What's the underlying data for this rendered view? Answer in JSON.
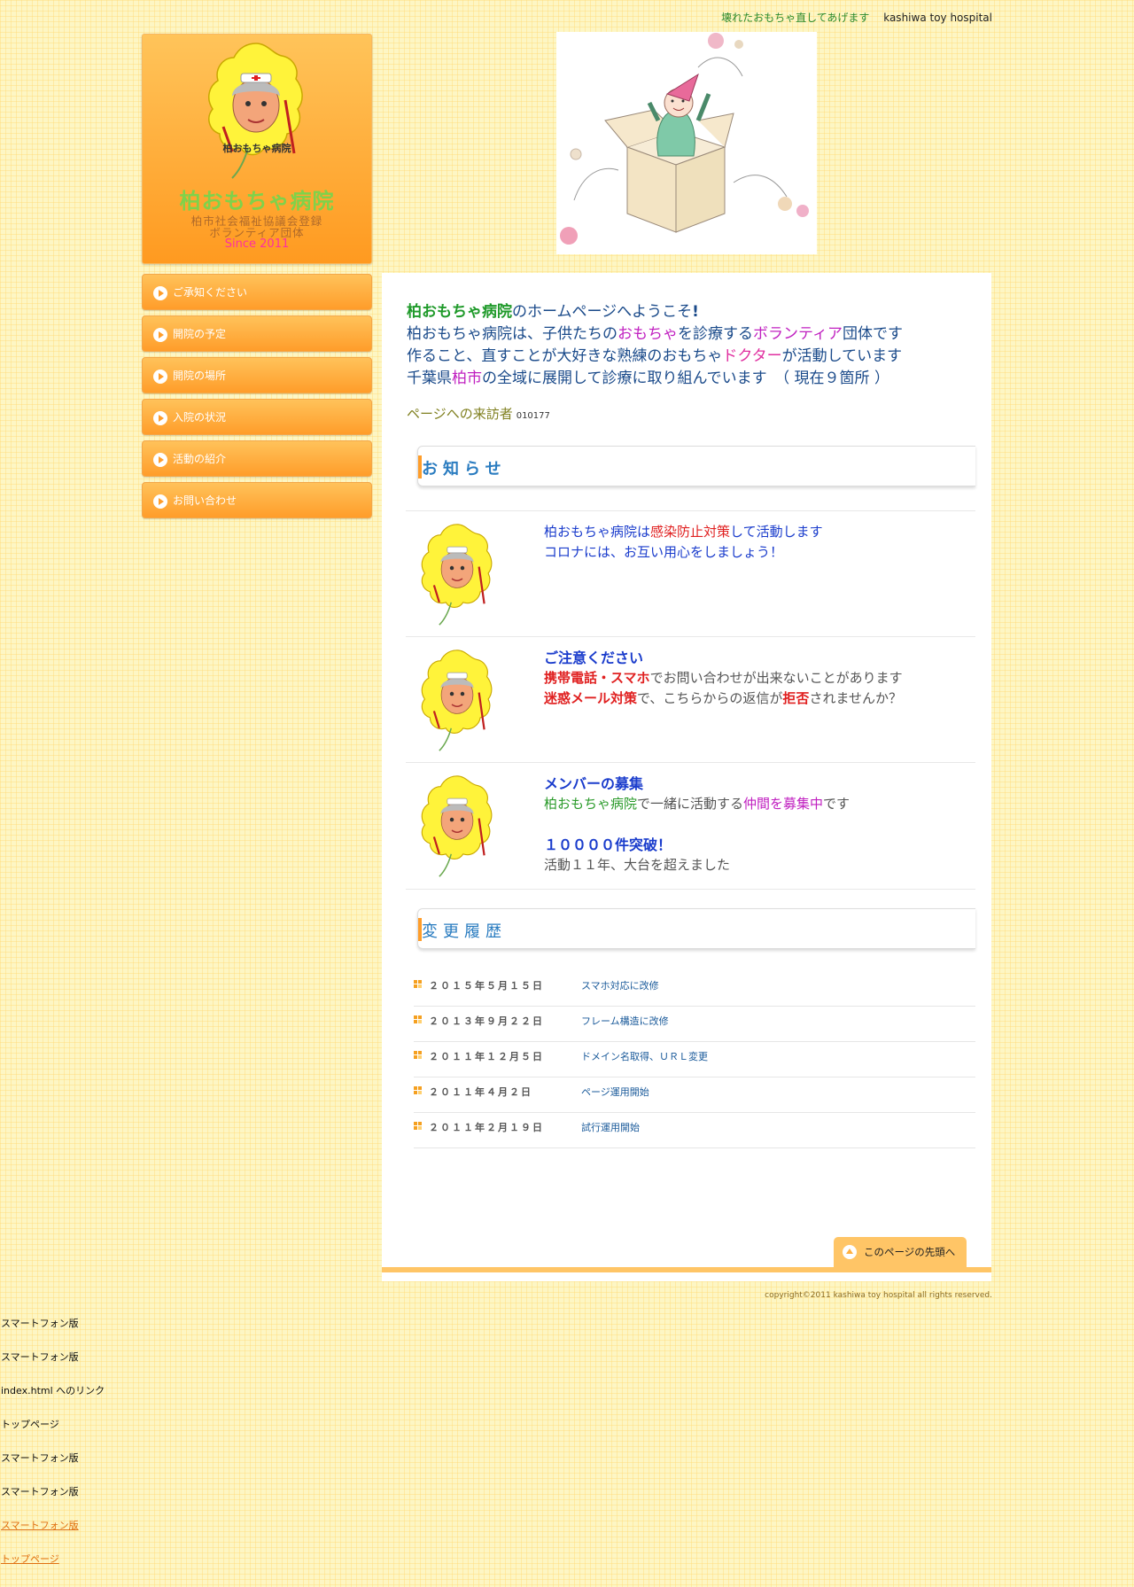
{
  "header": {
    "tagline_jp": "壊れたおもちゃ直してあげます",
    "tagline_en": "kashiwa toy hospital"
  },
  "logo": {
    "badge_text": "柏おもちゃ病院",
    "name": "柏おもちゃ病院",
    "registration_line1": "柏市社会福祉協議会登録",
    "registration_line2": "ボランティア団体",
    "since": "Since 2011"
  },
  "nav": {
    "items": [
      {
        "label": "ご承知ください"
      },
      {
        "label": "開院の予定"
      },
      {
        "label": "開院の場所"
      },
      {
        "label": "入院の状況"
      },
      {
        "label": "活動の紹介"
      },
      {
        "label": "お問い合わせ"
      }
    ]
  },
  "welcome": {
    "l1_a": "柏おもちゃ病院",
    "l1_b": "のホームページへようこそ",
    "l2_a": "柏おもちゃ病院は、子供たちの",
    "l2_b": "おもちゃ",
    "l2_c": "を診療する",
    "l2_d": "ボランティア",
    "l2_e": "団体です",
    "l3_a": "作ること、直すことが大好きな熟練のおもちゃ",
    "l3_b": "ドクター",
    "l3_c": "が活動しています",
    "l4_a": "千葉県",
    "l4_b": "柏市",
    "l4_c": "の全域に展開して診療に取り組んでいます　（ 現在９箇所 ）",
    "visitor_label": "ページへの来訪者",
    "visitor_count": "010177"
  },
  "notice": {
    "title": "お知らせ",
    "items": [
      {
        "a": "柏おもちゃ病院は",
        "b": "感染防止対策",
        "c": "して活動します",
        "d": "コロナには、お互い用心をしましょう！"
      },
      {
        "title": "ご注意ください",
        "a": "携帯電話・スマホ",
        "b": "でお問い合わせが出来ないことがあります",
        "c": "迷惑メール対策",
        "d": "で、こちらからの返信が",
        "e": "拒否",
        "f": "されませんか？"
      },
      {
        "title": "メンバーの募集",
        "a": "柏おもちゃ病院",
        "b": "で一緒に活動する",
        "c": "仲間を募集中",
        "d": "です",
        "e": "１００００件突破！",
        "f": "活動１１年、大台を超えました"
      }
    ]
  },
  "history": {
    "title": "変更履歴",
    "rows": [
      {
        "date": "２０１５年５月１５日",
        "desc": "スマホ対応に改修"
      },
      {
        "date": "２０１３年９月２２日",
        "desc": "フレーム構造に改修"
      },
      {
        "date": "２０１１年１２月５日",
        "desc": "ドメイン名取得、ＵＲＬ変更"
      },
      {
        "date": "２０１１年４月２日",
        "desc": "ページ運用開始"
      },
      {
        "date": "２０１１年２月１９日",
        "desc": "試行運用開始"
      }
    ]
  },
  "footer": {
    "to_top": "このページの先頭へ",
    "copyright": "copyright©2011 kashiwa toy hospital all rights reserved."
  },
  "bottom_links": [
    "スマートフォン版",
    "スマートフォン版",
    "index.html へのリンク",
    "トップページ",
    "スマートフォン版",
    "スマートフォン版",
    "スマートフォン版",
    "トップページ"
  ]
}
